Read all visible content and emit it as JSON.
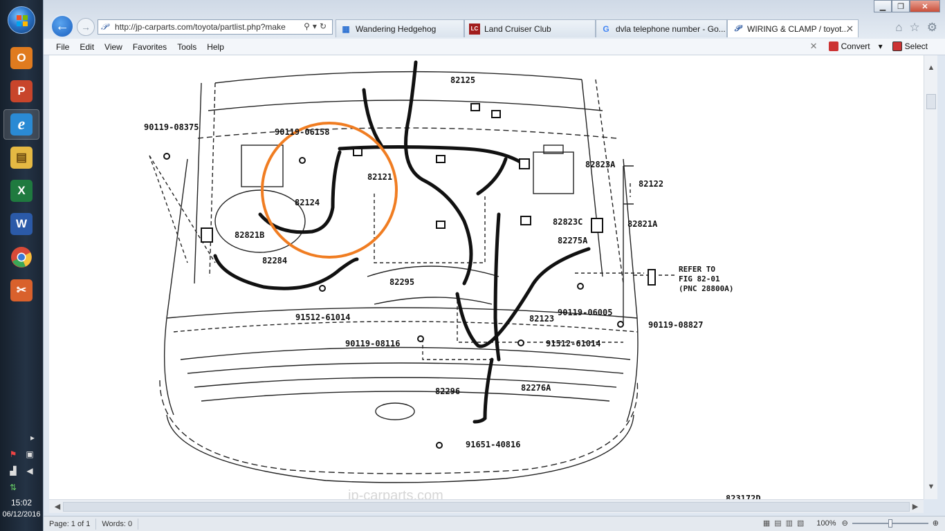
{
  "taskbar": {
    "apps": [
      {
        "icon": "outlook-icon",
        "glyph": "O",
        "color": "#e07b1f"
      },
      {
        "icon": "powerpoint-icon",
        "glyph": "P",
        "color": "#c8452b"
      },
      {
        "icon": "internet-explorer-icon",
        "glyph": "e",
        "color": "#2a8ad4"
      },
      {
        "icon": "file-explorer-icon",
        "glyph": "▤",
        "color": "#e5b943"
      },
      {
        "icon": "excel-icon",
        "glyph": "X",
        "color": "#1f7a3f"
      },
      {
        "icon": "word-icon",
        "glyph": "W",
        "color": "#2b5aa8"
      },
      {
        "icon": "chrome-icon",
        "glyph": "●",
        "color": "#d84a38"
      },
      {
        "icon": "snipping-tool-icon",
        "glyph": "✂",
        "color": "#d9612c"
      }
    ],
    "clock": {
      "time": "15:02",
      "date": "06/12/2016"
    }
  },
  "browser": {
    "url": "http://jp-carparts.com/toyota/partlist.php?make",
    "tabs": [
      {
        "label": "Wandering Hedgehog",
        "icon": "hedgehog-site-icon"
      },
      {
        "label": "Land Cruiser Club",
        "icon": "land-cruiser-club-icon"
      },
      {
        "label": "dvla telephone number - Go...",
        "icon": "google-icon"
      },
      {
        "label": "WIRING & CLAMP / toyot...",
        "icon": "ie-page-icon"
      }
    ],
    "menu": [
      "File",
      "Edit",
      "View",
      "Favorites",
      "Tools",
      "Help"
    ],
    "toolbar": {
      "convert": "Convert",
      "select": "Select"
    },
    "status": {
      "page": "Page: 1 of 1",
      "words": "Words: 0",
      "zoom": "100%"
    }
  },
  "diagram": {
    "watermark": "jp-carparts.com",
    "figure_code": "823172D",
    "highlight_color": "#f07d22",
    "labels": {
      "p82125": "82125",
      "p90119_08375": "90119-08375",
      "p90119_06158": "90119-06158",
      "p82121": "82121",
      "p82823A": "82823A",
      "p82122": "82122",
      "p82124": "82124",
      "p82823C": "82823C",
      "p82821A": "82821A",
      "p82821B": "82821B",
      "p82275A": "82275A",
      "p82284": "82284",
      "p82295": "82295",
      "p82123": "82123",
      "p91512_61014_a": "91512-61014",
      "p90119_06005": "90119-06005",
      "p90119_08827": "90119-08827",
      "p90119_08116": "90119-08116",
      "p91512_61014_b": "91512-61014",
      "p82296": "82296",
      "p82276A": "82276A",
      "p91651_40816": "91651-40816"
    },
    "reference": {
      "line1": "REFER TO",
      "line2": "FIG 82-01",
      "line3": "(PNC 28800A)"
    }
  }
}
